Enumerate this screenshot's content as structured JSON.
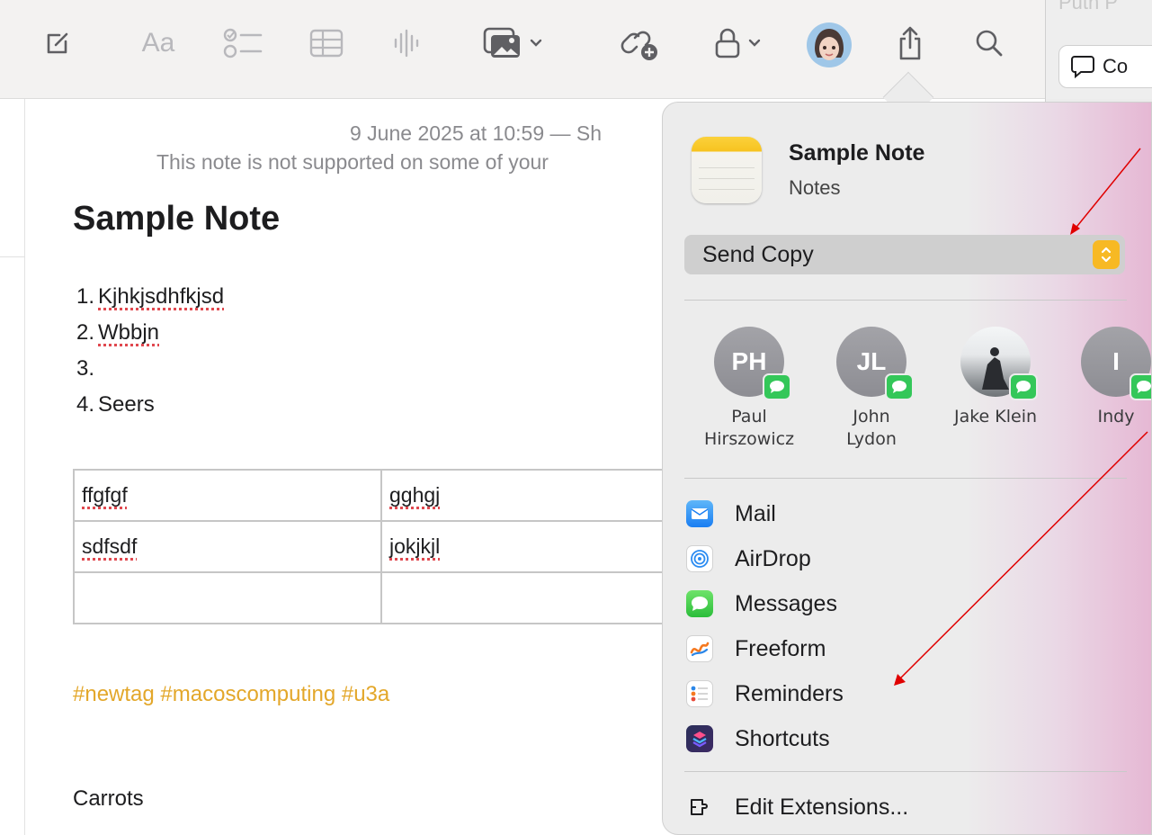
{
  "toolbar": {
    "icons": [
      "compose-icon",
      "format-text-icon",
      "checklist-icon",
      "table-icon",
      "audio-icon",
      "media-icon",
      "collaborate-icon",
      "lock-icon",
      "avatar-icon",
      "share-icon",
      "search-icon"
    ],
    "format_label": "Aa"
  },
  "right_window": {
    "cut_text": "Putn P",
    "comment_button_label": "Co"
  },
  "note": {
    "date_line": "9 June 2025 at 10:59 — Sh",
    "warning_line": "This note is not supported on some of your",
    "title": "Sample Note",
    "list": [
      {
        "number": "1.",
        "text": "Kjhkjsdhfkjsd"
      },
      {
        "number": "2.",
        "text": "Wbbjn"
      },
      {
        "number": "3.",
        "text": ""
      },
      {
        "number": "4.",
        "text": "Seers"
      }
    ],
    "table": [
      [
        "ffgfgf",
        "gghgj"
      ],
      [
        "sdfsdf",
        "jokjkjl"
      ],
      [
        "",
        ""
      ]
    ],
    "tags": "#newtag #macoscomputing #u3a",
    "last_line": "Carrots"
  },
  "share_sheet": {
    "title": "Sample Note",
    "subtitle": "Notes",
    "mode_select": "Send Copy",
    "people": [
      {
        "initials": "PH",
        "name_line1": "Paul",
        "name_line2": "Hirszowicz"
      },
      {
        "initials": "JL",
        "name_line1": "John",
        "name_line2": "Lydon"
      },
      {
        "initials": "",
        "name_line1": "Jake Klein",
        "name_line2": ""
      },
      {
        "initials": "I",
        "name_line1": "Indy",
        "name_line2": ""
      }
    ],
    "actions": [
      {
        "label": "Mail",
        "icon": "mail-icon"
      },
      {
        "label": "AirDrop",
        "icon": "airdrop-icon"
      },
      {
        "label": "Messages",
        "icon": "messages-icon"
      },
      {
        "label": "Freeform",
        "icon": "freeform-icon"
      },
      {
        "label": "Reminders",
        "icon": "reminders-icon"
      },
      {
        "label": "Shortcuts",
        "icon": "shortcuts-icon"
      }
    ],
    "edit_extensions": "Edit Extensions..."
  },
  "colors": {
    "tag_color": "#e3a72a",
    "select_accent": "#f7b924",
    "message_badge": "#34c759",
    "annotation_arrow": "#e00000"
  }
}
